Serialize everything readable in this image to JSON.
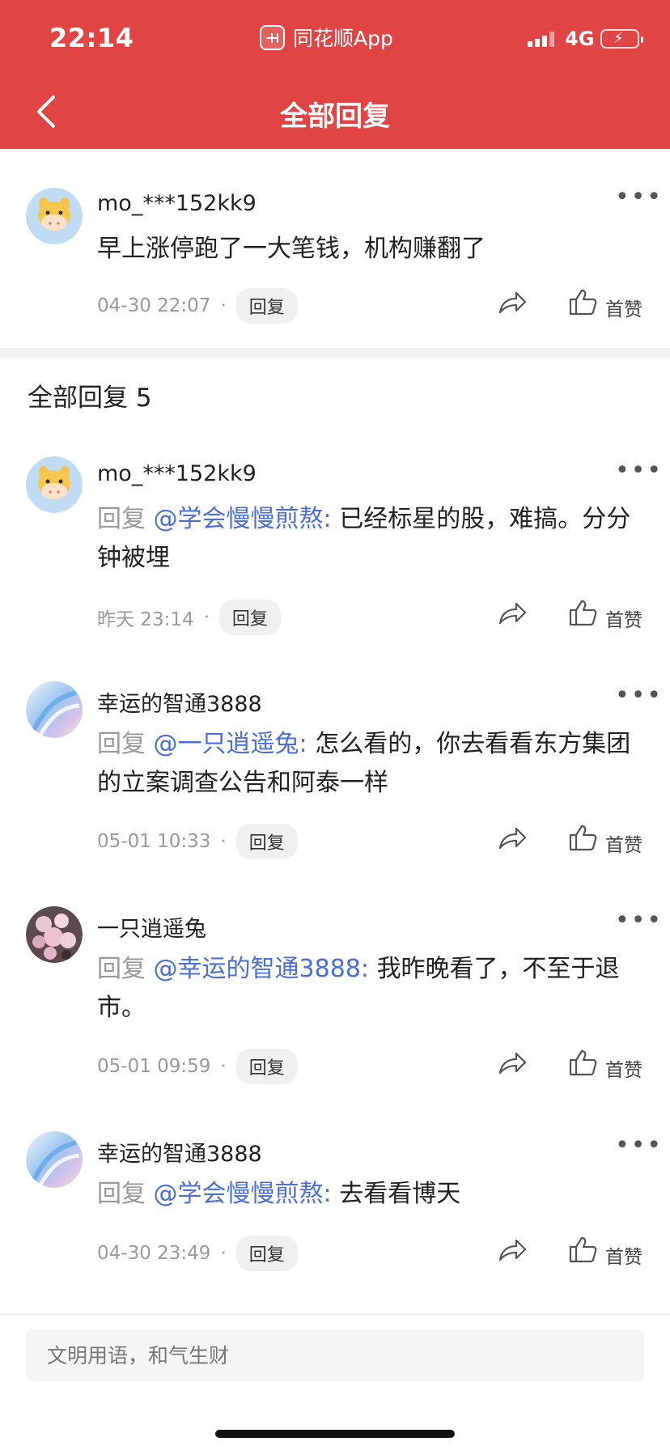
{
  "status_bar": {
    "time": "22:14",
    "app_name": "同花顺App",
    "network": "4G"
  },
  "header": {
    "title": "全部回复"
  },
  "main_comment": {
    "username": "mo_***152kk9",
    "text": "早上涨停跑了一大笔钱，机构赚翻了",
    "timestamp": "04-30 22:07",
    "reply_label": "回复",
    "like_label": "首赞"
  },
  "replies_section": {
    "title": "全部回复 5"
  },
  "replies": [
    {
      "username": "mo_***152kk9",
      "reply_prefix": "回复",
      "mention": "@学会慢慢煎熬:",
      "text": "已经标星的股，难搞。分分钟被埋",
      "timestamp": "昨天 23:14",
      "reply_label": "回复",
      "like_label": "首赞"
    },
    {
      "username": "幸运的智通3888",
      "reply_prefix": "回复",
      "mention": "@一只逍遥兔:",
      "text": "怎么看的，你去看看东方集团的立案调查公告和阿泰一样",
      "timestamp": "05-01 10:33",
      "reply_label": "回复",
      "like_label": "首赞"
    },
    {
      "username": "一只逍遥兔",
      "reply_prefix": "回复",
      "mention": "@幸运的智通3888:",
      "text": "我昨晚看了，不至于退市。",
      "timestamp": "05-01 09:59",
      "reply_label": "回复",
      "like_label": "首赞"
    },
    {
      "username": "幸运的智通3888",
      "reply_prefix": "回复",
      "mention": "@学会慢慢煎熬:",
      "text": "去看看博天",
      "timestamp": "04-30 23:49",
      "reply_label": "回复",
      "like_label": "首赞"
    }
  ],
  "input": {
    "placeholder": "文明用语，和气生财"
  },
  "icons": {
    "back": "chevron-left-icon",
    "more": "more-dots-icon",
    "share": "share-arrow-icon",
    "like": "thumbs-up-icon"
  },
  "colors": {
    "header_bg": "#e04543",
    "mention": "#4a6fd6",
    "meta_text": "#9a9a9a"
  }
}
